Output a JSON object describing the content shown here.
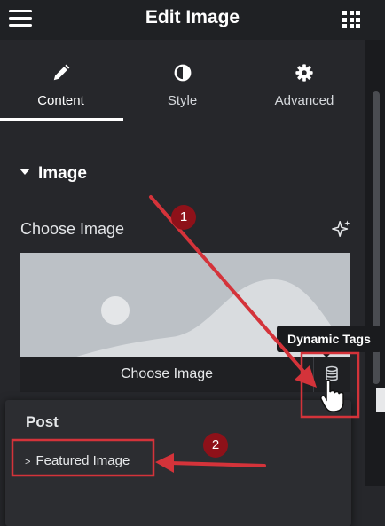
{
  "header": {
    "title": "Edit Image",
    "menu_icon": "hamburger-icon",
    "apps_icon": "grid-icon"
  },
  "tabs": [
    {
      "label": "Content",
      "icon": "pencil-icon",
      "active": true
    },
    {
      "label": "Style",
      "icon": "half-circle-icon",
      "active": false
    },
    {
      "label": "Advanced",
      "icon": "gear-icon",
      "active": false
    }
  ],
  "section": {
    "title": "Image"
  },
  "image_control": {
    "label": "Choose Image",
    "ai_icon": "sparkle-icon",
    "button_label": "Choose Image",
    "dynamic_icon": "database-icon"
  },
  "tooltip": {
    "text": "Dynamic Tags"
  },
  "dropdown": {
    "group": "Post",
    "items": [
      {
        "label": "Featured Image"
      }
    ]
  },
  "annotations": {
    "step1": "1",
    "step2": "2",
    "highlight_color": "#d4333a"
  },
  "colors": {
    "panel_bg": "#26272b",
    "topbar_bg": "#1f2124",
    "accent_red": "#d4333a"
  }
}
